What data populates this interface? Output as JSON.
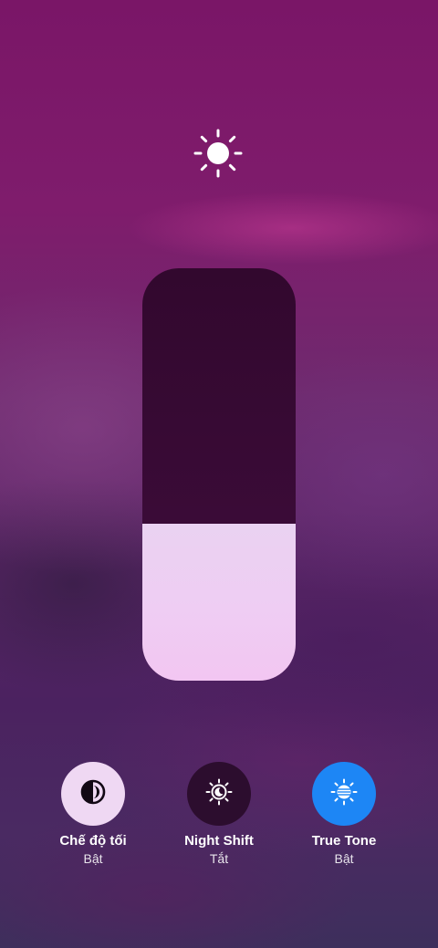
{
  "brightness": {
    "icon": "sun-icon",
    "level": 0.38
  },
  "controls": [
    {
      "id": "dark-mode",
      "icon": "dark-mode-icon",
      "label": "Chế độ tối",
      "status": "Bật",
      "accent": "#efd8f3"
    },
    {
      "id": "night-shift",
      "icon": "night-shift-icon",
      "label": "Night Shift",
      "status": "Tắt",
      "accent": "#2c0d2e"
    },
    {
      "id": "true-tone",
      "icon": "true-tone-icon",
      "label": "True Tone",
      "status": "Bật",
      "accent": "#1d86f5"
    }
  ]
}
